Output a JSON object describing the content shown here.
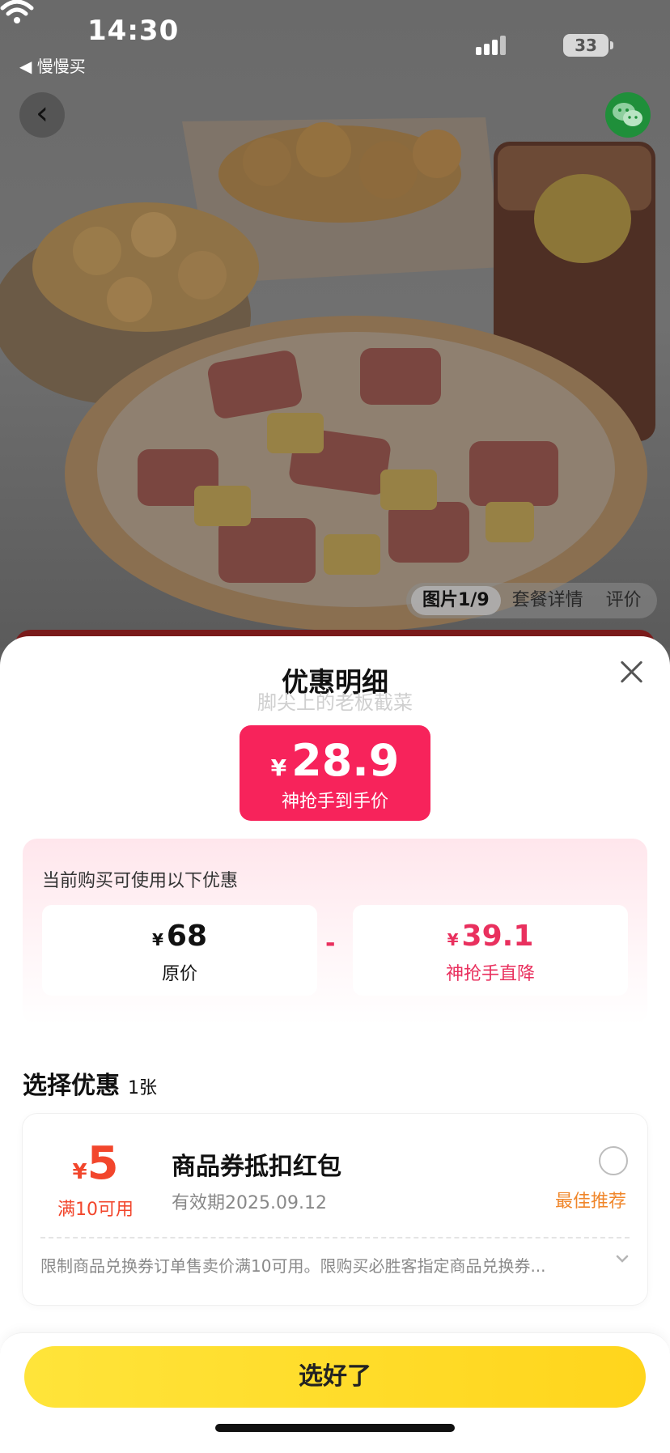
{
  "status_bar": {
    "time": "14:30",
    "back_app": "◀ 慢慢买",
    "battery": "33"
  },
  "gallery": {
    "tabs": [
      "图片1/9",
      "套餐详情",
      "评价"
    ],
    "active_tab": 0
  },
  "ghost_title": "脚尖上的老板截菜",
  "sheet": {
    "title": "优惠明细",
    "final_price": {
      "currency": "¥",
      "value": "28.9",
      "label": "神抢手到手价"
    },
    "breakdown": {
      "label": "当前购买可使用以下优惠",
      "original": {
        "currency": "¥",
        "value": "68",
        "label": "原价"
      },
      "operator": "-",
      "discount": {
        "currency": "¥",
        "value": "39.1",
        "label": "神抢手直降"
      }
    },
    "select_title": "选择优惠",
    "select_count": "1张",
    "coupon": {
      "currency": "¥",
      "amount": "5",
      "condition": "满10可用",
      "name": "商品券抵扣红包",
      "expiry": "有效期2025.09.12",
      "tag": "最佳推荐",
      "note": "限制商品兑换券订单售卖价满10可用。限购买必胜客指定商品兑换券..."
    },
    "confirm_label": "选好了"
  },
  "colors": {
    "price_red": "#f7235b",
    "discount_pink": "#e9305e",
    "coupon_orange": "#f2462c",
    "best_orange": "#f0862a",
    "button_yellow": "#ffd51c"
  }
}
